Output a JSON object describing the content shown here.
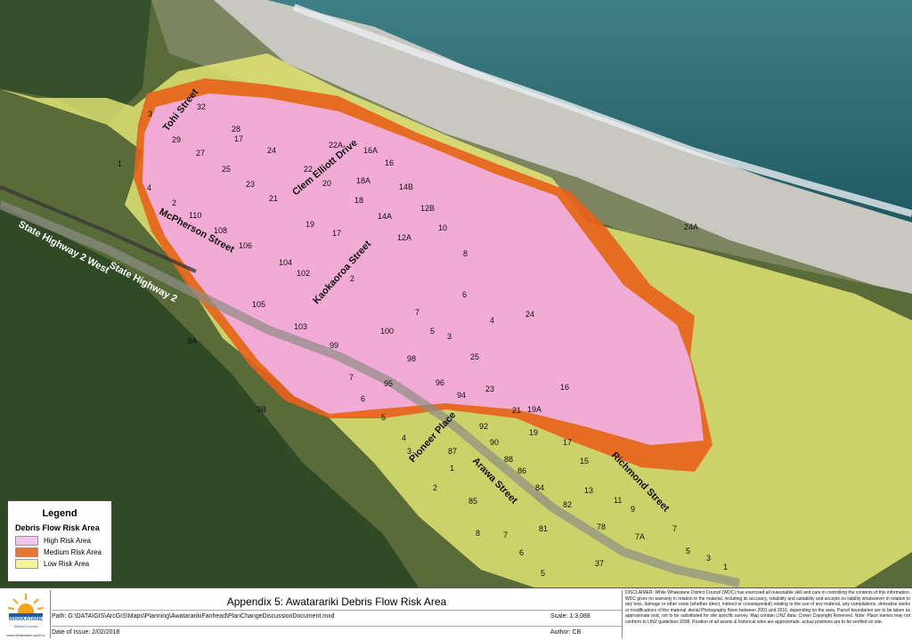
{
  "map": {
    "streets": [
      {
        "id": "tohi",
        "label": "Tohi Street"
      },
      {
        "id": "mcpherson",
        "label": "McPherson Street"
      },
      {
        "id": "sh2west",
        "label": "State Highway 2 West"
      },
      {
        "id": "sh2",
        "label": "State Highway 2"
      },
      {
        "id": "clem",
        "label": "Clem Elliott Drive"
      },
      {
        "id": "kaokaoroa",
        "label": "Kaokaoroa Street"
      },
      {
        "id": "pioneer",
        "label": "Pioneer Place"
      },
      {
        "id": "arawa",
        "label": "Arawa Street"
      },
      {
        "id": "richmond",
        "label": "Richmond Street"
      }
    ],
    "parcels": [
      "32",
      "3",
      "28",
      "17",
      "29",
      "24",
      "22A",
      "16A",
      "27",
      "25",
      "22",
      "20",
      "16",
      "1",
      "23",
      "18A",
      "14B",
      "4",
      "21",
      "18",
      "12B",
      "14A",
      "2",
      "110",
      "19",
      "10",
      "108",
      "17",
      "12A",
      "106",
      "8",
      "104",
      "102",
      "2",
      "6",
      "105",
      "7",
      "4",
      "24",
      "103",
      "5",
      "3",
      "100",
      "99",
      "98",
      "25",
      "7",
      "95",
      "96",
      "94",
      "23",
      "16",
      "6",
      "3B",
      "5",
      "21",
      "19A",
      "92",
      "4",
      "90",
      "19",
      "17",
      "3",
      "87",
      "88",
      "86",
      "15",
      "1",
      "84",
      "2",
      "13",
      "85",
      "82",
      "11",
      "9",
      "81",
      "78",
      "8",
      "7",
      "7A",
      "7",
      "6",
      "5",
      "3",
      "1",
      "37",
      "5",
      "3A",
      "24A"
    ],
    "colors": {
      "high_risk": "#f3b3e8",
      "medium_risk": "#e8601c",
      "low_risk": "#f3f37a"
    }
  },
  "legend": {
    "title": "Legend",
    "subtitle": "Debris Flow Risk Area",
    "items": [
      {
        "label": "High Risk Area",
        "color": "#f3c4ec"
      },
      {
        "label": "Medium Risk Area",
        "color": "#e8743a"
      },
      {
        "label": "Low Risk Area",
        "color": "#f5f59a"
      }
    ]
  },
  "footer": {
    "logo_name": "WHAKATANE",
    "logo_sub": "District Council",
    "logo_url": "www.whakatane.govt.nz",
    "title": "Appendix 5: Awatarariki Debris Flow Risk Area",
    "path": "Path: G:\\DATA\\GIS\\ArcGIS\\Maps\\Planning\\AwatararikiFanhead\\PlanChangeDiscussionDocument.mxd",
    "scale": "Scale:   1:3,088",
    "issue_date": "Date of Issue: 2/02/2018",
    "author": "Author:  CB",
    "disclaimer": "DISCLAIMER: While Whakatane District Council (WDC) has exercised all reasonable skill and care in controlling the contents of this information, WDC gives no warranty in relation to the material, including its accuracy, reliability and suitability and accepts no liability whatsoever in relation to any loss, damage or other costs (whether direct, indirect or consequential) relating to the use of any material, any compilations, derivative works or modifications of the material. Aerial Photography flown between 2001 and 2016, depending on the area. Parcel boundaries are to be taken as approximate only, not to be substituted for site specific survey. Map contain LINZ data: Crown Copyright Reserved. Note: Place names may not conform to LINZ guidelines 2008. Position of all assets & historical sites are approximate, actual positions are to be verified on site."
  }
}
